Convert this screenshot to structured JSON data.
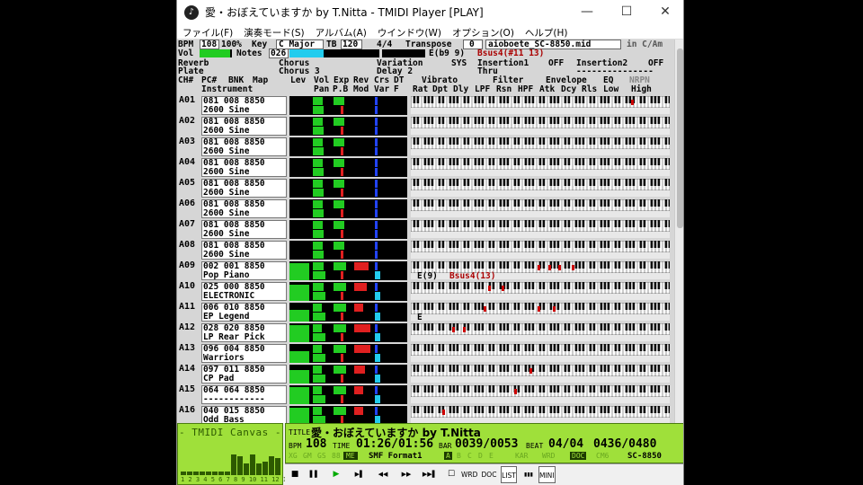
{
  "window": {
    "title": "愛・おぼえていますか by T.Nitta - TMIDI Player [PLAY]",
    "min": "—",
    "max": "☐",
    "close": "✕"
  },
  "menu": [
    "ファイル(F)",
    "演奏モード(S)",
    "アルバム(A)",
    "ウインドウ(W)",
    "オプション(O)",
    "ヘルプ(H)"
  ],
  "header": {
    "bpm_label": "BPM",
    "bpm": "108",
    "pct": "100%",
    "key_label": "Key",
    "key": "C Major",
    "tb_label": "TB",
    "tb": "120",
    "timesig": "4/4",
    "transpose_label": "Transpose",
    "transpose": "0",
    "file": "aioboete_SC-8850.mid",
    "keymode": "in C/Am",
    "vol_label": "Vol",
    "notes_label": "Notes",
    "notes": "026",
    "chord1": "E(b9 9)",
    "chord2": "Bsus4(#11 13)",
    "reverb_label": "Reverb",
    "reverb": "Plate",
    "chorus_label": "Chorus",
    "chorus": "Chorus 3",
    "variation_label": "Variation",
    "variation": "Delay 2",
    "sys": "SYS",
    "ins1_label": "Insertion1",
    "ins1": "OFF",
    "ins1_type": "Thru",
    "ins2_label": "Insertion2",
    "ins2": "OFF",
    "ins2_type": "---------------"
  },
  "columns": {
    "ch": "CH#",
    "pc": "PC#",
    "bnk": "BNK",
    "map": "Map",
    "instrument": "Instrument",
    "lev": "Lev",
    "vol": "Vol",
    "pan": "Pan",
    "pb": "P.B",
    "exp": "Exp",
    "mod": "Mod",
    "rev": "Rev",
    "var": "Var",
    "crs": "Crs",
    "f": "F",
    "dt": "DT",
    "vibrato": "Vibrato",
    "rat": "Rat",
    "dpt": "Dpt",
    "dly": "Dly",
    "filter": "Filter",
    "lpf": "LPF",
    "rsn": "Rsn",
    "hpf": "HPF",
    "envelope": "Envelope",
    "atk": "Atk",
    "dcy": "Dcy",
    "rls": "Rls",
    "eq": "EQ",
    "low": "Low",
    "high": "High",
    "nrpn": "NRPN"
  },
  "channels": [
    {
      "ch": "A01",
      "line1": "081 008 8850",
      "line2": "2600 Sine",
      "lev": 0,
      "vol": 0.55,
      "exp": 0.6,
      "rev": 0.0,
      "keys": [
        0.85
      ],
      "chord": ""
    },
    {
      "ch": "A02",
      "line1": "081 008 8850",
      "line2": "2600 Sine",
      "lev": 0,
      "vol": 0.55,
      "exp": 0.6,
      "rev": 0.0,
      "keys": [],
      "chord": ""
    },
    {
      "ch": "A03",
      "line1": "081 008 8850",
      "line2": "2600 Sine",
      "lev": 0,
      "vol": 0.55,
      "exp": 0.6,
      "rev": 0.0,
      "keys": [],
      "chord": ""
    },
    {
      "ch": "A04",
      "line1": "081 008 8850",
      "line2": "2600 Sine",
      "lev": 0,
      "vol": 0.55,
      "exp": 0.6,
      "rev": 0.0,
      "keys": [],
      "chord": ""
    },
    {
      "ch": "A05",
      "line1": "081 008 8850",
      "line2": "2600 Sine",
      "lev": 0,
      "vol": 0.55,
      "exp": 0.6,
      "rev": 0.0,
      "keys": [],
      "chord": ""
    },
    {
      "ch": "A06",
      "line1": "081 008 8850",
      "line2": "2600 Sine",
      "lev": 0,
      "vol": 0.55,
      "exp": 0.6,
      "rev": 0.0,
      "keys": [],
      "chord": ""
    },
    {
      "ch": "A07",
      "line1": "081 008 8850",
      "line2": "2600 Sine",
      "lev": 0,
      "vol": 0.55,
      "exp": 0.6,
      "rev": 0.0,
      "keys": [],
      "chord": ""
    },
    {
      "ch": "A08",
      "line1": "081 008 8850",
      "line2": "2600 Sine",
      "lev": 0,
      "vol": 0.55,
      "exp": 0.6,
      "rev": 0.0,
      "keys": [],
      "chord": ""
    },
    {
      "ch": "A09",
      "line1": "002 001 8850",
      "line2": "Pop Piano",
      "lev": 0.9,
      "vol": 0.6,
      "exp": 0.7,
      "rev": 0.8,
      "keys": [
        0.49,
        0.53,
        0.57,
        0.62
      ],
      "chord": "E(9)",
      "chord2": "Bsus4(13)"
    },
    {
      "ch": "A10",
      "line1": "025 000 8850",
      "line2": "ELECTRONIC",
      "lev": 0.85,
      "vol": 0.6,
      "exp": 0.7,
      "rev": 0.7,
      "keys": [
        0.3,
        0.35
      ],
      "chord": ""
    },
    {
      "ch": "A11",
      "line1": "006 010 8850",
      "line2": "EP Legend",
      "lev": 0.6,
      "vol": 0.5,
      "exp": 0.7,
      "rev": 0.5,
      "keys": [
        0.28,
        0.49,
        0.55
      ],
      "chord": "E"
    },
    {
      "ch": "A12",
      "line1": "028 020 8850",
      "line2": "LP Rear Pick",
      "lev": 0.9,
      "vol": 0.5,
      "exp": 0.7,
      "rev": 0.9,
      "keys": [
        0.16,
        0.2
      ],
      "chord": ""
    },
    {
      "ch": "A13",
      "line1": "096 004 8850",
      "line2": "Warriors",
      "lev": 0.6,
      "vol": 0.5,
      "exp": 0.7,
      "rev": 0.9,
      "keys": [],
      "chord": ""
    },
    {
      "ch": "A14",
      "line1": "097 011 8850",
      "line2": "CP Pad",
      "lev": 0.7,
      "vol": 0.5,
      "exp": 0.7,
      "rev": 0.6,
      "keys": [
        0.46
      ],
      "chord": ""
    },
    {
      "ch": "A15",
      "line1": "064 064 8850",
      "line2": "------------",
      "lev": 0.9,
      "vol": 0.5,
      "exp": 0.7,
      "rev": 0.5,
      "keys": [
        0.4
      ],
      "chord": ""
    },
    {
      "ch": "A16",
      "line1": "040 015 8850",
      "line2": "Odd Bass",
      "lev": 0.9,
      "vol": 0.5,
      "exp": 0.7,
      "rev": 0.5,
      "keys": [
        0.12
      ],
      "chord": ""
    }
  ],
  "canvas": {
    "title": "- TMIDI Canvas -",
    "channel_numbers": "1 2 3 4 5 6 7 8 9 10 11 12 13 14 15 16",
    "levels": [
      0.1,
      0.1,
      0.1,
      0.1,
      0.1,
      0.1,
      0.1,
      0.1,
      0.55,
      0.5,
      0.3,
      0.55,
      0.3,
      0.35,
      0.5,
      0.45
    ]
  },
  "info": {
    "title_label": "TITLE",
    "title": "愛・おぼえていますか by T.Nitta",
    "bpm_label": "BPM",
    "bpm": "108",
    "time_label": "TIME",
    "time": "01:26/01:56",
    "bar_label": "BAR",
    "bar": "0039/0053",
    "beat_label": "BEAT",
    "beat": "04/04",
    "tick": "0436/0480",
    "mode_tags": [
      "XG",
      "GM",
      "GS",
      "88",
      "ME"
    ],
    "format": "SMF Format1",
    "part_tags": [
      "A",
      "B",
      "C",
      "D",
      "E"
    ],
    "status_tags": [
      "KAR",
      "WRD",
      "DOC",
      "CM6"
    ],
    "doc": "DOC",
    "module": "SC-8850"
  },
  "toolbar": {
    "stop": "■",
    "pause": "▌▌",
    "play": "▶",
    "prev": "▶▌",
    "rew": "◀◀",
    "ff": "▶▶",
    "next": "▶▶▌",
    "rec": "☐",
    "wrd": "WRD",
    "doc": "DOC",
    "list": "LIST",
    "bars": "▮▮▮",
    "mini": "MINI"
  },
  "colors": {
    "lcd": "#9fe03a",
    "meter_green": "#22cc22",
    "meter_red": "#e02020",
    "meter_blue": "#2244ff",
    "meter_cyan": "#22ccee"
  }
}
